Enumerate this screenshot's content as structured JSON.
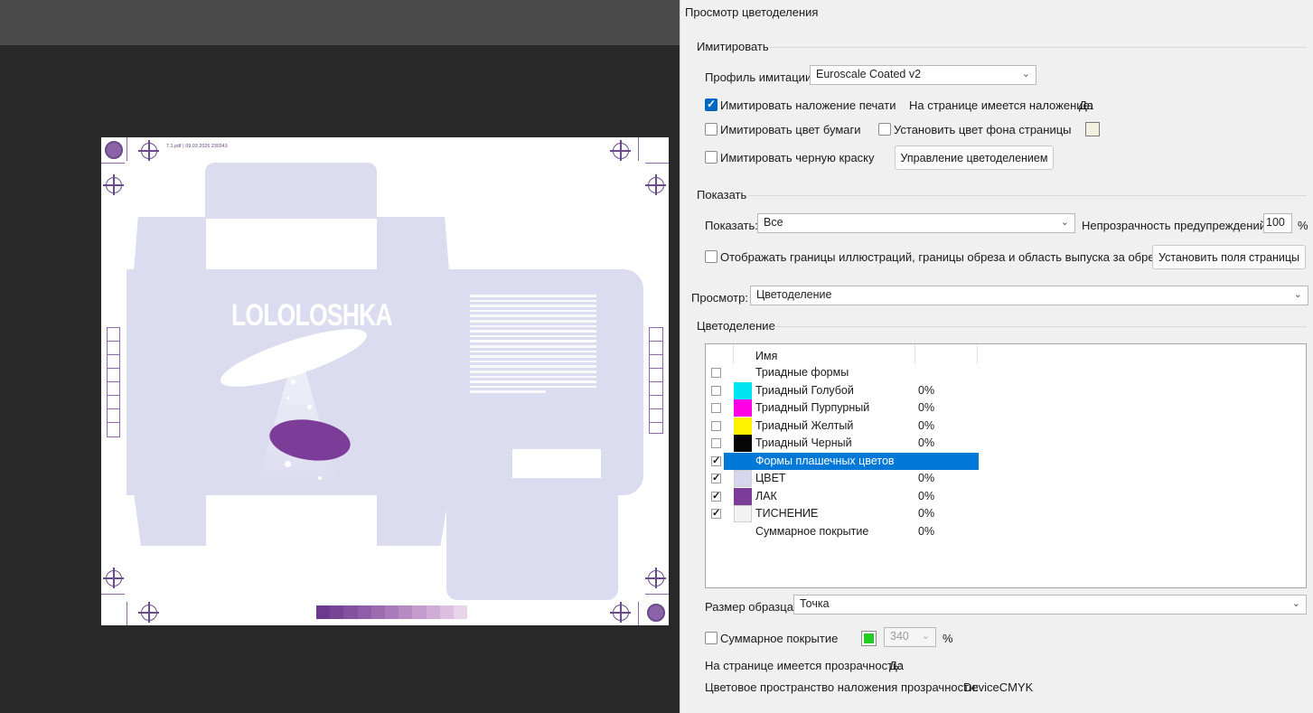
{
  "dialog": {
    "title": "Просмотр цветоделения",
    "simulate": {
      "group_label": "Имитировать",
      "profile_label": "Профиль имитации:",
      "profile_value": "Euroscale Coated v2",
      "overprint_label": "Имитировать наложение печати",
      "overprint_checked": true,
      "page_has_overprint": "На странице имеется наложение:",
      "page_has_overprint_value": "Да",
      "paper_color_label": "Имитировать цвет бумаги",
      "page_bg_label": "Установить цвет фона страницы",
      "black_ink_label": "Имитировать черную краску",
      "manage_button": "Управление цветоделением"
    },
    "show": {
      "group_label": "Показать",
      "show_label": "Показать:",
      "show_value": "Все",
      "warning_opacity_label": "Непрозрачность предупреждений:",
      "warning_opacity_value": "100",
      "percent": "%",
      "bounds_label": "Отображать границы иллюстраций, границы обреза и область выпуска за обрез",
      "set_page_boxes_button": "Установить поля страницы"
    },
    "preview": {
      "label": "Просмотр:",
      "value": "Цветоделение"
    },
    "separations": {
      "group_label": "Цветоделение",
      "column_name": "Имя",
      "rows": [
        {
          "name": "Триадные формы",
          "pct": "",
          "swatch": "",
          "checked": false,
          "selected": false
        },
        {
          "name": "Триадный Голубой",
          "pct": "0%",
          "swatch": "#00e5f2",
          "checked": false,
          "selected": false
        },
        {
          "name": "Триадный Пурпурный",
          "pct": "0%",
          "swatch": "#ff00e6",
          "checked": false,
          "selected": false
        },
        {
          "name": "Триадный Желтый",
          "pct": "0%",
          "swatch": "#fff200",
          "checked": false,
          "selected": false
        },
        {
          "name": "Триадный Черный",
          "pct": "0%",
          "swatch": "#050505",
          "checked": false,
          "selected": false
        },
        {
          "name": "Формы плашечных цветов",
          "pct": "",
          "swatch": "",
          "checked": true,
          "selected": true
        },
        {
          "name": "ЦВЕТ",
          "pct": "0%",
          "swatch": "#d6d6ee",
          "checked": true,
          "selected": false
        },
        {
          "name": "ЛАК",
          "pct": "0%",
          "swatch": "#7b3d97",
          "checked": true,
          "selected": false
        },
        {
          "name": "ТИСНЕНИЕ",
          "pct": "0%",
          "swatch": "#f2f2f2",
          "checked": true,
          "selected": false
        },
        {
          "name": "Суммарное покрытие",
          "pct": "0%",
          "swatch": "",
          "checked": null,
          "selected": false
        }
      ]
    },
    "sample": {
      "label": "Размер образца:",
      "value": "Точка"
    },
    "total_coverage": {
      "label": "Суммарное покрытие",
      "color": "#22cc22",
      "value": "340",
      "percent": "%"
    },
    "transparency": {
      "label": "На странице имеется прозрачность:",
      "value": "Да"
    },
    "blend_space": {
      "label": "Цветовое пространство наложения прозрачности:",
      "value": "DeviceCMYK"
    }
  },
  "artwork": {
    "slug": "7.1.pdf  |  09.03.2026  230243",
    "logo": "LOLOLOSHKA",
    "die_color": "#dcdcf0",
    "varnish_color": "#7b3d97",
    "strip_colors": [
      "#6b3a8e",
      "#774596",
      "#83519f",
      "#8f5ea8",
      "#9c6cb1",
      "#a97bba",
      "#b68ac3",
      "#c39bcc",
      "#d0add6",
      "#ddc0df",
      "#e9d5ea"
    ]
  }
}
